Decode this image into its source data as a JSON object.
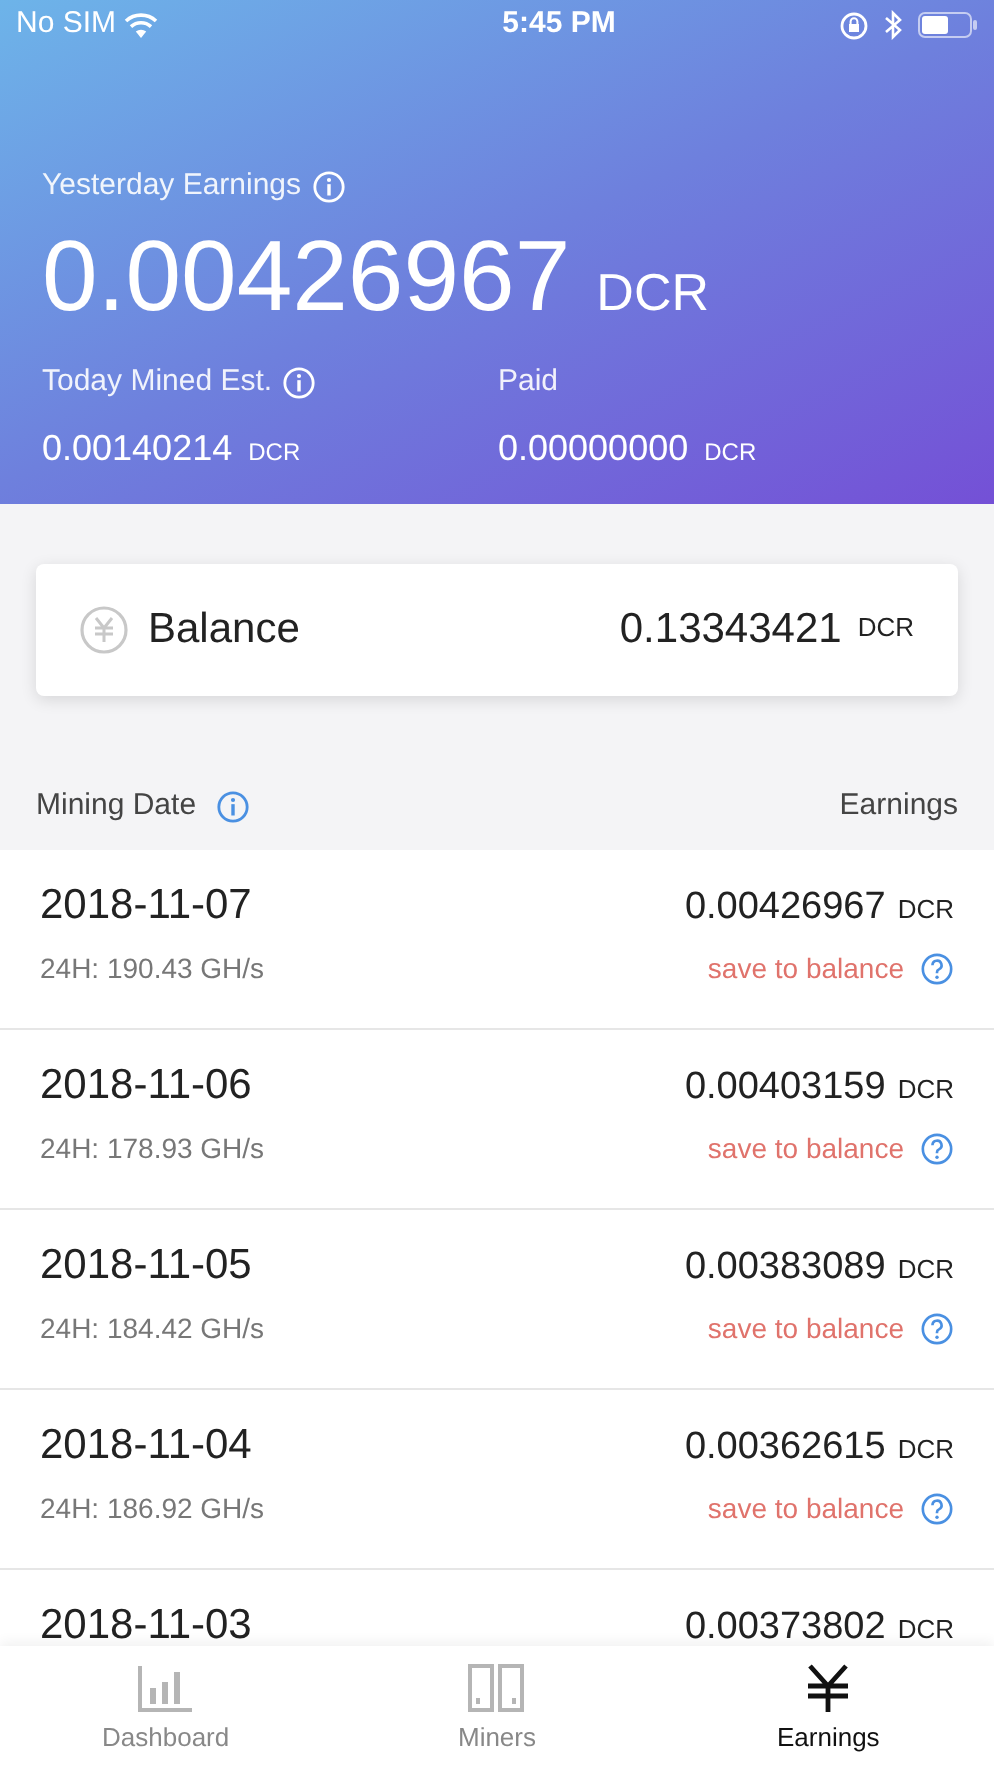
{
  "status_bar": {
    "carrier": "No SIM",
    "time": "5:45 PM"
  },
  "summary": {
    "yesterday_label": "Yesterday Earnings",
    "yesterday_value": "0.00426967",
    "yesterday_unit": "DCR",
    "today_label": "Today Mined Est.",
    "today_value": "0.00140214",
    "today_unit": "DCR",
    "paid_label": "Paid",
    "paid_value": "0.00000000",
    "paid_unit": "DCR"
  },
  "balance": {
    "label": "Balance",
    "value": "0.13343421",
    "unit": "DCR"
  },
  "list_header": {
    "date_label": "Mining Date",
    "earnings_label": "Earnings"
  },
  "rows": [
    {
      "date": "2018-11-07",
      "hashrate": "24H: 190.43 GH/s",
      "amount": "0.00426967",
      "unit": "DCR",
      "action": "save to balance"
    },
    {
      "date": "2018-11-06",
      "hashrate": "24H: 178.93 GH/s",
      "amount": "0.00403159",
      "unit": "DCR",
      "action": "save to balance"
    },
    {
      "date": "2018-11-05",
      "hashrate": "24H: 184.42 GH/s",
      "amount": "0.00383089",
      "unit": "DCR",
      "action": "save to balance"
    },
    {
      "date": "2018-11-04",
      "hashrate": "24H: 186.92 GH/s",
      "amount": "0.00362615",
      "unit": "DCR",
      "action": "save to balance"
    },
    {
      "date": "2018-11-03",
      "amount": "0.00373802",
      "unit": "DCR"
    }
  ],
  "tabs": [
    {
      "label": "Dashboard",
      "kind": "chart",
      "selected": false
    },
    {
      "label": "Miners",
      "kind": "miners",
      "selected": false
    },
    {
      "label": "Earnings",
      "kind": "yen",
      "selected": true
    }
  ]
}
